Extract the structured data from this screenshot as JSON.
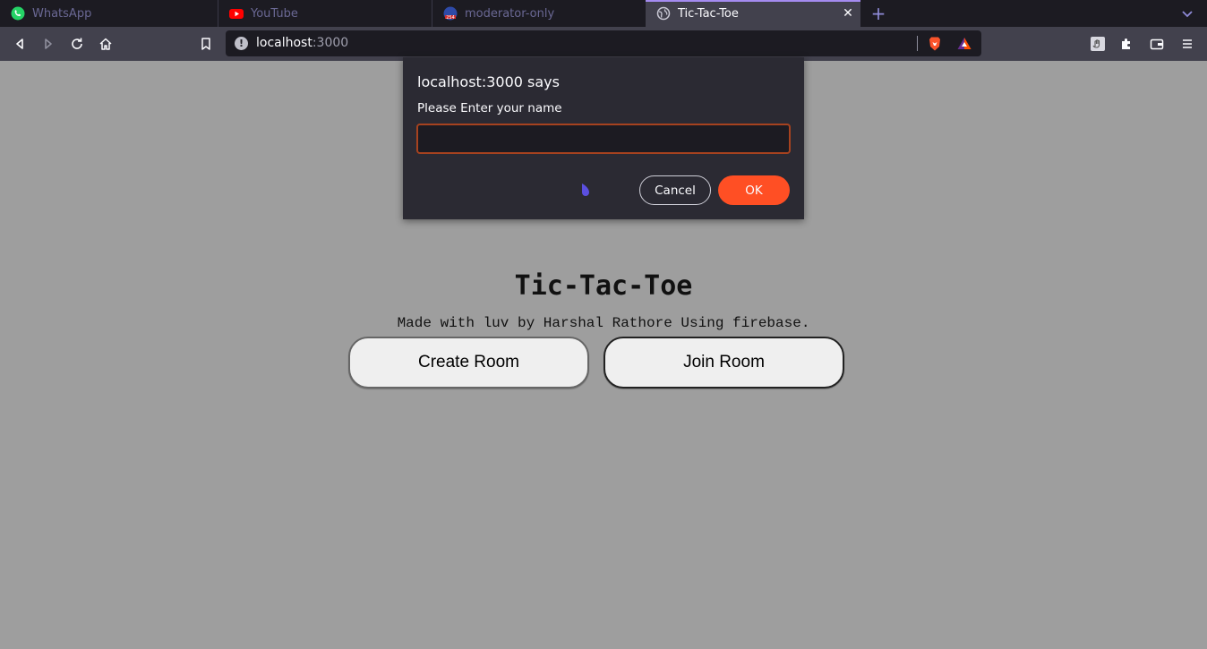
{
  "browser": {
    "tabs": [
      {
        "title": "WhatsApp",
        "icon": "whatsapp-icon"
      },
      {
        "title": "YouTube",
        "icon": "youtube-icon"
      },
      {
        "title": "moderator-only",
        "icon": "channel-254-icon"
      },
      {
        "title": "Tic-Tac-Toe",
        "icon": "globe-icon",
        "active": true
      }
    ],
    "url": {
      "host": "localhost",
      "port": ":3000"
    }
  },
  "page": {
    "title": "Tic-Tac-Toe",
    "subtitle": "Made with luv by Harshal Rathore Using firebase.",
    "create_room_label": "Create Room",
    "join_room_label": "Join Room"
  },
  "dialog": {
    "title": "localhost:3000 says",
    "message": "Please Enter your name",
    "input_value": "",
    "cancel_label": "Cancel",
    "ok_label": "OK"
  },
  "colors": {
    "page_background": "#9e9e9e",
    "dialog_background": "#2b2a33",
    "ok_button": "#ff4f24",
    "active_tab_accent": "#a48bf0"
  }
}
